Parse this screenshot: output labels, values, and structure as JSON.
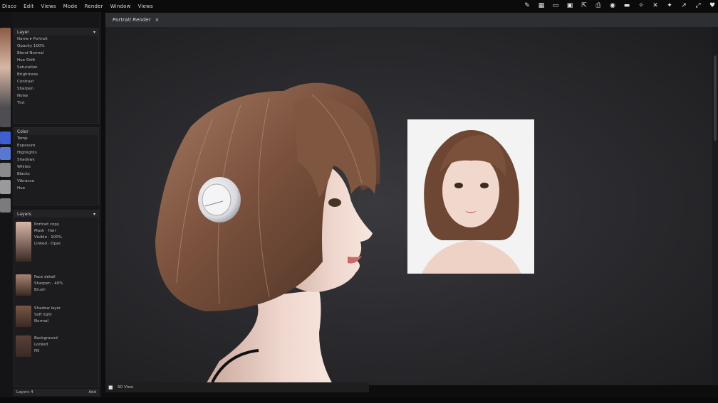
{
  "menu": {
    "items": [
      "Disco",
      "Edit",
      "Views",
      "Mode",
      "Render",
      "Window",
      "Views"
    ]
  },
  "toolbar": {
    "icons": [
      "brush-icon",
      "layers-icon",
      "frame-icon",
      "grid-icon",
      "transform-icon",
      "save-icon",
      "camera-icon",
      "wand-icon",
      "search-icon",
      "close-icon",
      "settings-icon",
      "share-icon",
      "expand-icon",
      "heart-icon"
    ],
    "glyphs": [
      "✎",
      "▦",
      "▭",
      "▣",
      "⇱",
      "⎙",
      "◉",
      "▬",
      "✧",
      "✕",
      "✦",
      "↗",
      "⤢",
      "♥"
    ]
  },
  "panels": {
    "properties": {
      "title": "Layer",
      "rows": [
        "Name ▸ Portrait",
        "Opacity 100%",
        "Blend Normal",
        "Hue Shift",
        "Saturation",
        "Brightness",
        "Contrast",
        "Sharpen",
        "Noise",
        "Tint"
      ]
    },
    "adjustments": {
      "title": "Color",
      "rows": [
        "Temp",
        "Exposure",
        "Highlights",
        "Shadows",
        "Whites",
        "Blacks",
        "Vibrance",
        "Hue"
      ]
    },
    "layers": {
      "title": "Layers",
      "items": [
        {
          "lines": [
            "Portrait copy",
            "Mask · Hair",
            "Visible · 100%",
            "Linked · Opac"
          ]
        },
        {
          "lines": [
            "Face detail",
            "Sharpen · 40%",
            "Brush"
          ]
        },
        {
          "lines": [
            "Shadow layer",
            "Soft light",
            "Normal"
          ]
        },
        {
          "lines": [
            "Background",
            "Locked",
            "Fill"
          ]
        }
      ],
      "footer_left": "Layers 4",
      "footer_right": "Add"
    }
  },
  "document": {
    "tab_label": "Portrait Render",
    "tab_close": "×",
    "status": "3D View"
  },
  "colors": {
    "hair": "#6b4634",
    "hair_highlight": "#a57a62",
    "skin": "#f0d6cc",
    "headphone": "#e9e9ec"
  }
}
